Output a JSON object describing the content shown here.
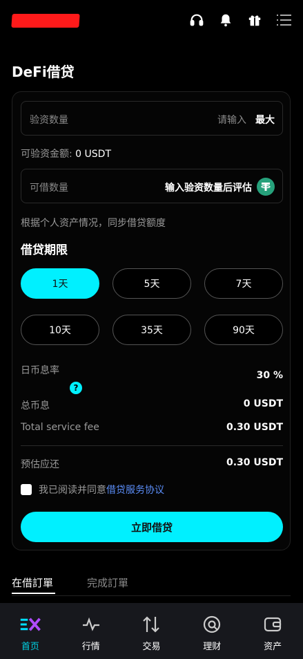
{
  "header": {
    "icons": [
      "headset-icon",
      "bell-icon",
      "gift-icon",
      "menu-icon"
    ]
  },
  "page": {
    "title": "DeFi借贷"
  },
  "form": {
    "verify_label": "验资数量",
    "verify_placeholder": "请输入",
    "max_label": "最大",
    "available_label": "可验资金额:",
    "available_value": "0 USDT",
    "borrow_label": "可借数量",
    "borrow_eval": "输入验资数量后评估",
    "borrow_icon": "usdt-icon",
    "hint": "根据个人资产情况，同步借贷额度"
  },
  "period": {
    "title": "借贷期限",
    "options": [
      "1天",
      "5天",
      "7天",
      "10天",
      "35天",
      "90天"
    ],
    "selected_index": 0
  },
  "summary": {
    "daily_rate_label": "日币息率",
    "daily_rate_value": "30 %",
    "total_interest_label": "总币息",
    "total_interest_value": "0 USDT",
    "service_fee_label": "Total service fee",
    "service_fee_value": "0.30 USDT",
    "estimated_label": "预估应还",
    "estimated_value": "0.30 USDT"
  },
  "agreement": {
    "text": "我已阅读并同意",
    "link": "借贷服务协议",
    "checked": false
  },
  "submit_label": "立即借贷",
  "order_tabs": [
    "在借訂單",
    "完成訂單"
  ],
  "bottom_nav": [
    {
      "label": "首页",
      "icon": "home-logo-icon",
      "active": true
    },
    {
      "label": "行情",
      "icon": "pulse-icon",
      "active": false
    },
    {
      "label": "交易",
      "icon": "swap-icon",
      "active": false
    },
    {
      "label": "理财",
      "icon": "finance-icon",
      "active": false
    },
    {
      "label": "资产",
      "icon": "wallet-icon",
      "active": false
    }
  ],
  "colors": {
    "accent": "#00f0ff",
    "link": "#5b8df7",
    "usdt": "#26a17b",
    "brand_red": "#ff1a1a"
  }
}
